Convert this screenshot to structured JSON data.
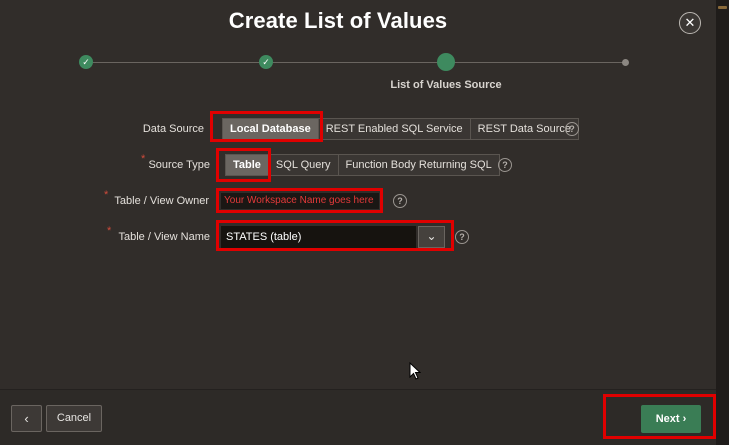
{
  "dialog": {
    "title": "Create List of Values",
    "close_glyph": "✕"
  },
  "progress": {
    "done_glyph": "✓",
    "current_step_label": "List of Values Source",
    "steps": [
      {
        "state": "complete"
      },
      {
        "state": "complete"
      },
      {
        "state": "current"
      },
      {
        "state": "future"
      }
    ]
  },
  "form": {
    "data_source": {
      "label": "Data Source",
      "options": [
        "Local Database",
        "REST Enabled SQL Service",
        "REST Data Source"
      ],
      "selected": "Local Database"
    },
    "source_type": {
      "label": "Source Type",
      "required_mark": "*",
      "options": [
        "Table",
        "SQL Query",
        "Function Body Returning SQL"
      ],
      "selected": "Table"
    },
    "owner": {
      "label": "Table / View Owner",
      "required_mark": "*",
      "value": "Your Workspace Name goes here"
    },
    "table_name": {
      "label": "Table / View Name",
      "required_mark": "*",
      "value": "STATES (table)",
      "button_glyph": "⌄"
    },
    "help_glyph": "?"
  },
  "footer": {
    "back_glyph": "‹",
    "cancel_label": "Cancel",
    "next_label": "Next",
    "next_glyph": "›"
  },
  "colors": {
    "background": "#312d2a",
    "accent_green": "#3a7d55",
    "highlight_red": "#e00000"
  }
}
